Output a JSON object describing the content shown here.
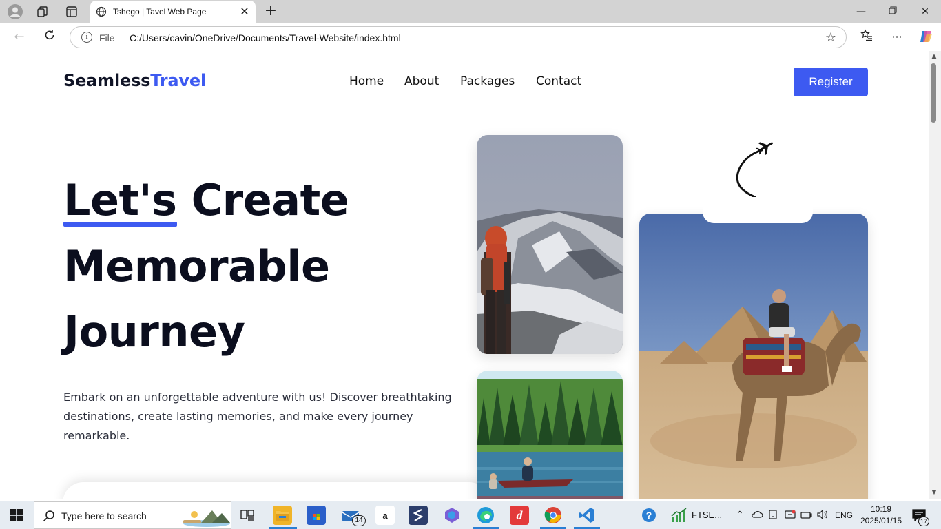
{
  "browser": {
    "tab_title": "Tshego | Tavel Web Page",
    "url_scheme_label": "File",
    "url": "C:/Users/cavin/OneDrive/Documents/Travel-Website/index.html"
  },
  "site": {
    "logo_primary": "Seamless",
    "logo_accent": "Travel",
    "nav": {
      "home": "Home",
      "about": "About",
      "packages": "Packages",
      "contact": "Contact"
    },
    "register_label": "Register",
    "hero": {
      "underlined_word": "Let's",
      "line1_rest": " Create",
      "line2": "Memorable",
      "line3": "Journey",
      "description": "Embark on an unforgettable adventure with us! Discover breathtaking destinations, create lasting memories, and make every journey remarkable."
    },
    "colors": {
      "accent": "#3d5af1",
      "heading": "#0b0e1e"
    }
  },
  "taskbar": {
    "search_placeholder": "Type here to search",
    "mail_badge": "14",
    "amazon_label": "a",
    "stock_ticker": "FTSE...",
    "language": "ENG",
    "time": "10:19",
    "date": "2025/01/15",
    "notification_count": "17"
  }
}
